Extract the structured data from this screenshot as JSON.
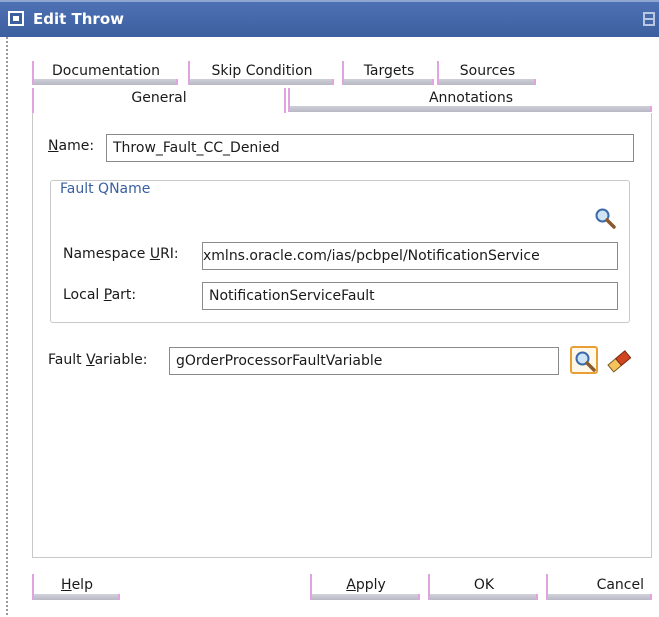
{
  "window": {
    "title": "Edit Throw"
  },
  "tabs": {
    "row1": [
      {
        "label": "Documentation"
      },
      {
        "label": "Skip Condition"
      },
      {
        "label": "Targets"
      },
      {
        "label": "Sources"
      }
    ],
    "row2": [
      {
        "label": "General",
        "active": true
      },
      {
        "label": "Annotations"
      }
    ]
  },
  "form": {
    "name_label_prefix": "N",
    "name_label_rest": "ame:",
    "name_value": "Throw_Fault_CC_Denied",
    "fault_qname": {
      "legend": "Fault QName",
      "namespace_label_prefix": "Namespace ",
      "namespace_label_mnemonic": "U",
      "namespace_label_rest": "RI:",
      "namespace_value": "xmlns.oracle.com/ias/pcbpel/NotificationService",
      "local_label_prefix": "Local ",
      "local_label_mnemonic": "P",
      "local_label_rest": "art:",
      "local_value": "NotificationServiceFault"
    },
    "fault_variable_label_prefix": "Fault ",
    "fault_variable_label_mnemonic": "V",
    "fault_variable_label_rest": "ariable:",
    "fault_variable_value": "gOrderProcessorFaultVariable"
  },
  "buttons": {
    "help_mnemonic": "H",
    "help_rest": "elp",
    "apply_mnemonic": "A",
    "apply_rest": "pply",
    "ok": "OK",
    "cancel": "Cancel"
  },
  "icons": {
    "search": "search-icon",
    "browse": "browse-variable-icon",
    "clear": "eraser-icon"
  }
}
